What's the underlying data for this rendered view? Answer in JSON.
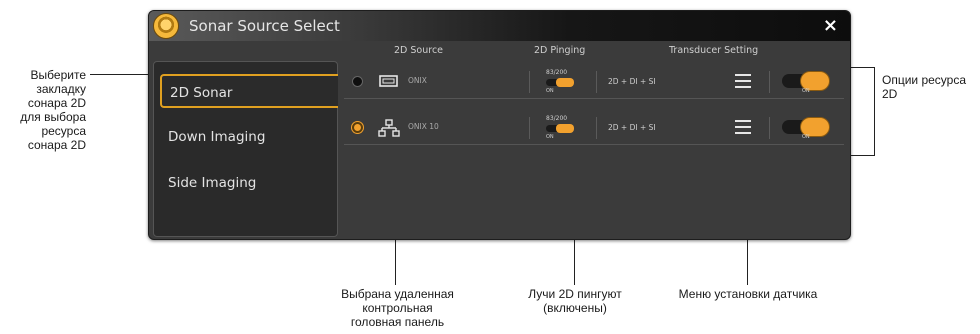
{
  "window": {
    "title": "Sonar Source Select",
    "close_label": "×"
  },
  "columns": {
    "source": "2D Source",
    "pinging": "2D Pinging",
    "transducer": "Transducer Setting"
  },
  "tabs": [
    {
      "label": "2D Sonar",
      "active": true
    },
    {
      "label": "Down Imaging",
      "active": false
    },
    {
      "label": "Side Imaging",
      "active": false
    }
  ],
  "rows": [
    {
      "selected": false,
      "source_icon": "display-icon",
      "source_name": "ONIX",
      "ping_label": "83/200",
      "ping_state": "ON",
      "setting": "2D + DI + SI",
      "toggle_state": "ON"
    },
    {
      "selected": true,
      "source_icon": "network-icon",
      "source_name": "ONIX 10",
      "ping_label": "83/200",
      "ping_state": "ON",
      "setting": "2D + DI + SI",
      "toggle_state": "ON"
    }
  ],
  "callouts": {
    "tab": "Выберите\nзакладку\nсонара 2D\nдля выбора\nресурса\nсонара 2D",
    "options": "Опции ресурса 2D",
    "remote": "Выбрана удаленная\nконтрольная\nголовная панель",
    "pinging": "Лучи 2D пингуют\n(включены)",
    "menu": "Меню установки датчика"
  },
  "colors": {
    "accent": "#f2a12e",
    "window_bg": "#3b3b3b",
    "tab_border": "#e0a020"
  }
}
